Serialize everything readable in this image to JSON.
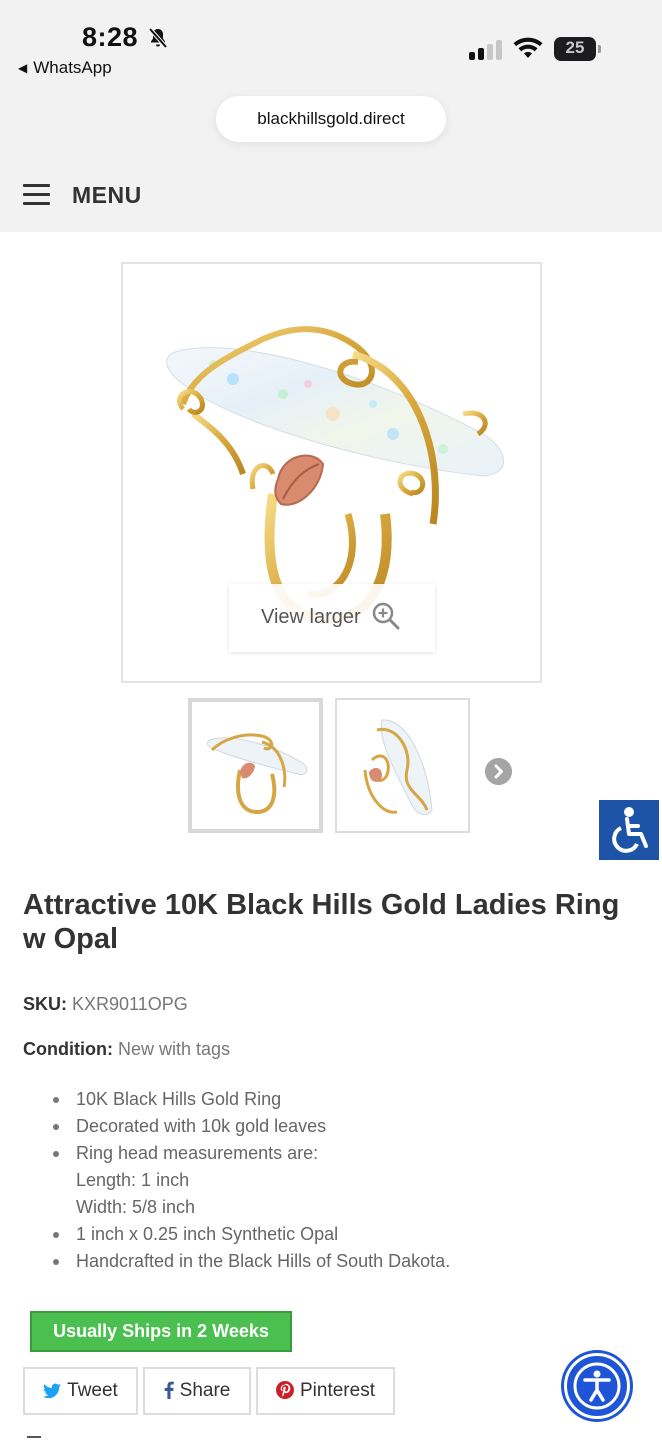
{
  "status_bar": {
    "time": "8:28",
    "back_app": "WhatsApp",
    "battery": "25"
  },
  "browser": {
    "url": "blackhillsgold.direct"
  },
  "header": {
    "menu_label": "MENU"
  },
  "gallery": {
    "view_larger_label": "View larger"
  },
  "product": {
    "title": "Attractive 10K Black Hills Gold Ladies Ring w Opal",
    "sku_label": "SKU:",
    "sku_value": "KXR9011OPG",
    "condition_label": "Condition:",
    "condition_value": "New with tags",
    "features": [
      "10K Black Hills Gold Ring",
      "Decorated with 10k gold leaves",
      "Ring head measurements are:",
      "1 inch x 0.25 inch Synthetic Opal",
      "Handcrafted in the Black Hills of South Dakota."
    ],
    "measurements": [
      "Length: 1 inch",
      "Width: 5/8 inch"
    ],
    "shipping_badge": "Usually Ships in 2 Weeks"
  },
  "share": {
    "tweet": "Tweet",
    "share": "Share",
    "pinterest": "Pinterest"
  },
  "colors": {
    "ship_green": "#4bbf50",
    "a11y_blue": "#1e54d6",
    "twitter_blue": "#1da1f2",
    "facebook_blue": "#3b5998",
    "pinterest_red": "#cb2027"
  },
  "icons": [
    "bell-off-icon",
    "signal-icon",
    "wifi-icon",
    "battery-icon",
    "hamburger-icon",
    "zoom-in-icon",
    "chevron-right-icon",
    "accessibility-icon",
    "twitter-icon",
    "facebook-icon",
    "pinterest-icon"
  ]
}
